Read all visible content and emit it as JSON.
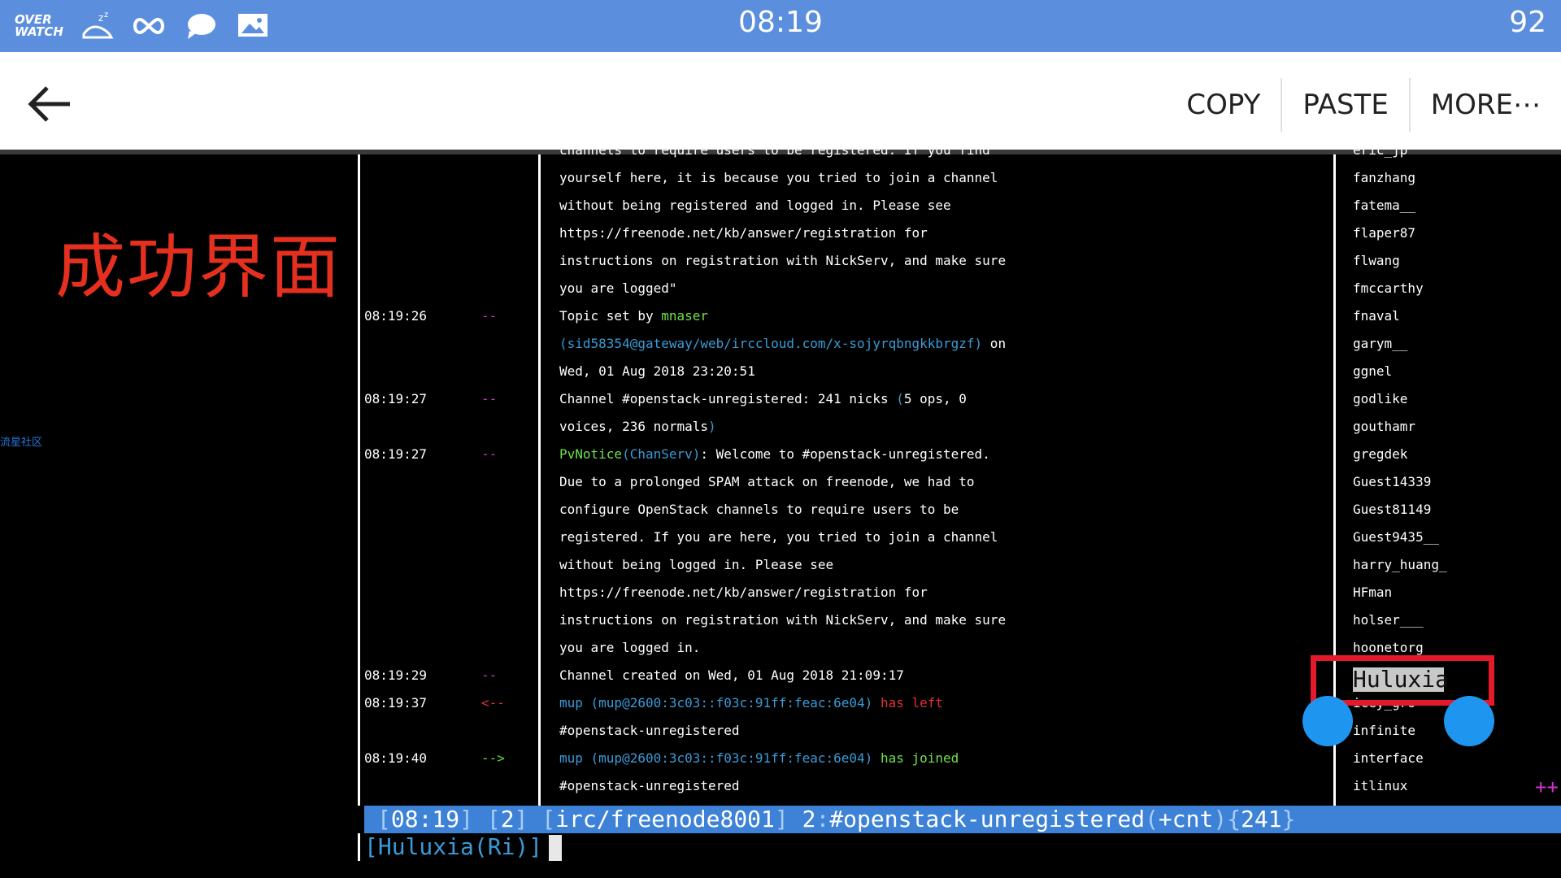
{
  "statusbar": {
    "logo_top": "OVER",
    "logo_bottom": "WATCH",
    "time": "08:19",
    "battery": "92",
    "icons": [
      "overwatch-logo-icon",
      "sleep-bird-icon",
      "infinity-icon",
      "chat-bubble-icon",
      "image-message-icon"
    ]
  },
  "actionbar": {
    "copy": "COPY",
    "paste": "PASTE",
    "more": "MORE⋯"
  },
  "overlay": {
    "caption": "成功界面",
    "watermark": "流星社区"
  },
  "colors": {
    "statusbar": "#5b8fde",
    "selection_box": "#e41a2a",
    "handle": "#1e96f0",
    "status_line": "#3d82d6"
  },
  "log": [
    {
      "ts": "",
      "pfx": "",
      "segs": [
        {
          "t": "channels to require users to be registered. If you find",
          "c": ""
        }
      ]
    },
    {
      "ts": "",
      "pfx": "",
      "segs": [
        {
          "t": "yourself here, it is because you tried to join a channel",
          "c": ""
        }
      ]
    },
    {
      "ts": "",
      "pfx": "",
      "segs": [
        {
          "t": "without being registered and logged in. Please see",
          "c": ""
        }
      ]
    },
    {
      "ts": "",
      "pfx": "",
      "segs": [
        {
          "t": "https://freenode.net/kb/answer/registration for",
          "c": ""
        }
      ]
    },
    {
      "ts": "",
      "pfx": "",
      "segs": [
        {
          "t": "instructions on registration with NickServ, and make sure",
          "c": ""
        }
      ]
    },
    {
      "ts": "",
      "pfx": "",
      "segs": [
        {
          "t": "you are logged\"",
          "c": ""
        }
      ]
    },
    {
      "ts": "08:19:26",
      "pfx": "--",
      "pc": "c-mag",
      "segs": [
        {
          "t": "Topic set by ",
          "c": ""
        },
        {
          "t": "mnaser",
          "c": "c-green"
        }
      ]
    },
    {
      "ts": "",
      "pfx": "",
      "segs": [
        {
          "t": "(sid58354@gateway/web/irccloud.com/x-sojyrqbngkkbrgzf)",
          "c": "c-cyan"
        },
        {
          "t": " on",
          "c": ""
        }
      ]
    },
    {
      "ts": "",
      "pfx": "",
      "segs": [
        {
          "t": "Wed, 01 Aug 2018 23:20:51",
          "c": ""
        }
      ]
    },
    {
      "ts": "08:19:27",
      "pfx": "--",
      "pc": "c-mag",
      "segs": [
        {
          "t": "Channel #openstack-unregistered: 241 nicks ",
          "c": ""
        },
        {
          "t": "(",
          "c": "c-cyan"
        },
        {
          "t": "5 ops, 0",
          "c": ""
        }
      ]
    },
    {
      "ts": "",
      "pfx": "",
      "segs": [
        {
          "t": "voices, 236 normals",
          "c": ""
        },
        {
          "t": ")",
          "c": "c-cyan"
        }
      ]
    },
    {
      "ts": "08:19:27",
      "pfx": "--",
      "pc": "c-mag",
      "segs": [
        {
          "t": "PvNotice",
          "c": "c-green"
        },
        {
          "t": "(",
          "c": "c-cyan"
        },
        {
          "t": "ChanServ",
          "c": "c-cyan"
        },
        {
          "t": ")",
          "c": "c-cyan"
        },
        {
          "t": ": Welcome to #openstack-unregistered.",
          "c": ""
        }
      ]
    },
    {
      "ts": "",
      "pfx": "",
      "segs": [
        {
          "t": "Due to a prolonged SPAM attack on freenode, we had to",
          "c": ""
        }
      ]
    },
    {
      "ts": "",
      "pfx": "",
      "segs": [
        {
          "t": "configure OpenStack channels to require users to be",
          "c": ""
        }
      ]
    },
    {
      "ts": "",
      "pfx": "",
      "segs": [
        {
          "t": "registered. If you are here, you tried to join a channel",
          "c": ""
        }
      ]
    },
    {
      "ts": "",
      "pfx": "",
      "segs": [
        {
          "t": "without being logged in. Please see",
          "c": ""
        }
      ]
    },
    {
      "ts": "",
      "pfx": "",
      "segs": [
        {
          "t": "https://freenode.net/kb/answer/registration for",
          "c": ""
        }
      ]
    },
    {
      "ts": "",
      "pfx": "",
      "segs": [
        {
          "t": "instructions on registration with NickServ, and make sure",
          "c": ""
        }
      ]
    },
    {
      "ts": "",
      "pfx": "",
      "segs": [
        {
          "t": "you are logged in.",
          "c": ""
        }
      ]
    },
    {
      "ts": "08:19:29",
      "pfx": "--",
      "pc": "c-mag",
      "segs": [
        {
          "t": "Channel created on Wed, 01 Aug 2018 21:09:17",
          "c": ""
        }
      ]
    },
    {
      "ts": "08:19:37",
      "pfx": "<--",
      "pc": "c-red",
      "segs": [
        {
          "t": "mup ",
          "c": "c-cyan"
        },
        {
          "t": "(mup@2600:3c03::f03c:91ff:feac:6e04)",
          "c": "c-cyan"
        },
        {
          "t": " has left",
          "c": "c-red"
        }
      ]
    },
    {
      "ts": "",
      "pfx": "",
      "segs": [
        {
          "t": "#openstack-unregistered",
          "c": ""
        }
      ]
    },
    {
      "ts": "08:19:40",
      "pfx": "-->",
      "pc": "c-lime",
      "segs": [
        {
          "t": "mup ",
          "c": "c-cyan"
        },
        {
          "t": "(mup@2600:3c03::f03c:91ff:feac:6e04)",
          "c": "c-cyan"
        },
        {
          "t": " has joined",
          "c": "c-green"
        }
      ]
    },
    {
      "ts": "",
      "pfx": "",
      "segs": [
        {
          "t": "#openstack-unregistered",
          "c": ""
        }
      ]
    }
  ],
  "nicks": [
    "eric_jp",
    "fanzhang",
    "fatema__",
    "flaper87",
    "flwang",
    "fmccarthy",
    "fnaval",
    "garym__",
    "ggnel",
    "godlike",
    "gouthamr",
    "gregdek",
    "Guest14339",
    "Guest81149",
    "Guest9435__",
    "harry_huang_",
    "HFman",
    "holser___",
    "hoonetorg",
    "Huluxia",
    "icey_gro",
    "infinite",
    "interface",
    "itlinux"
  ],
  "statusline": {
    "time": "08:19",
    "window": "2",
    "network": "irc/freenode8001",
    "num": "2",
    "channel": "#openstack-unregistered",
    "mode": "+cnt",
    "count": "241"
  },
  "input": {
    "prompt": "[Huluxia(Ri)]"
  },
  "selection": {
    "text": "Huluxia"
  },
  "more_indicator": "++"
}
